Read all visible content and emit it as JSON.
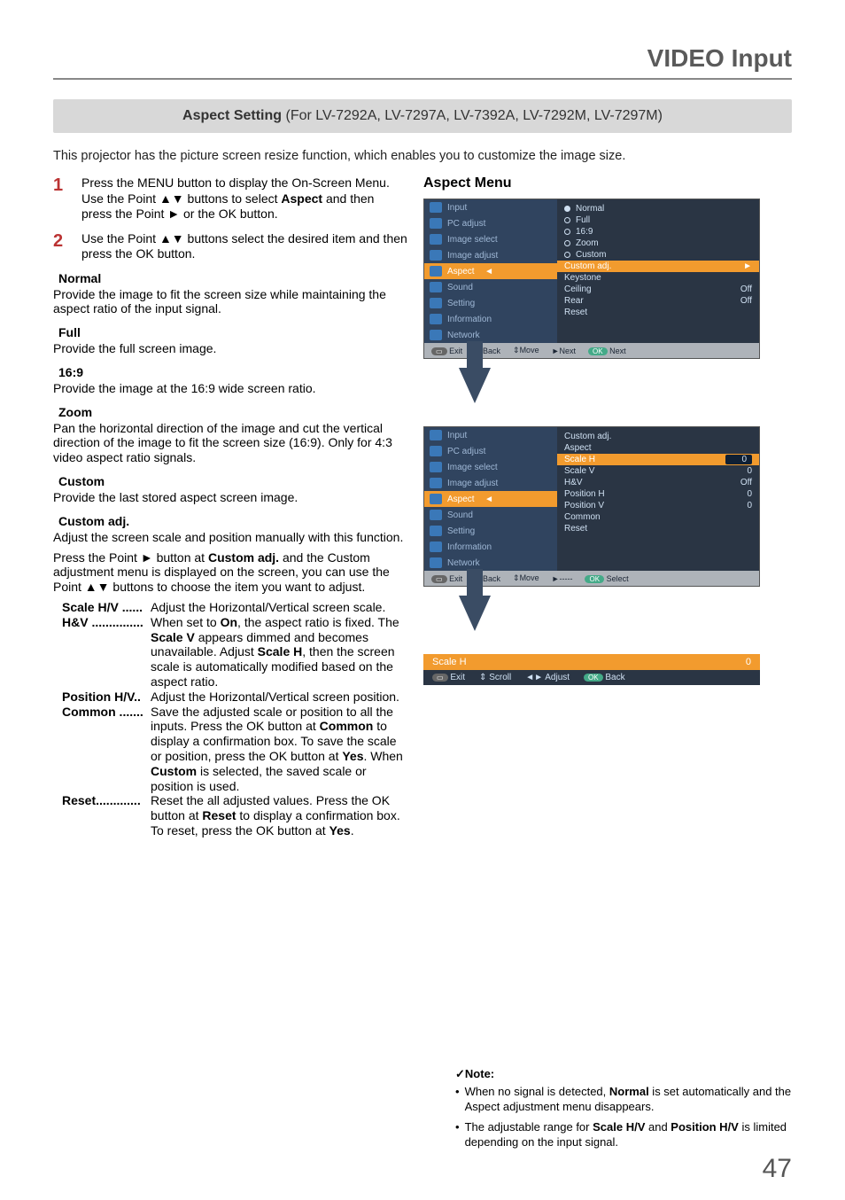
{
  "header": {
    "title": "VIDEO Input"
  },
  "section": {
    "title_bold": "Aspect Setting",
    "title_rest": "(For LV-7292A, LV-7297A, LV-7392A, LV-7292M, LV-7297M)"
  },
  "intro": "This projector has the picture screen resize function, which enables you to customize the image size.",
  "steps": {
    "s1_num": "1",
    "s1_pre": "Press the MENU button to display the On-Screen Menu. Use the Point ▲▼ buttons to select ",
    "s1_bold": "Aspect",
    "s1_post": " and then press the Point ► or the OK button.",
    "s2_num": "2",
    "s2": "Use the Point ▲▼ buttons select the desired item and then press the OK button."
  },
  "items": {
    "normal_h": "Normal",
    "normal_p": "Provide the image to fit the screen size while maintaining the aspect ratio of the input signal.",
    "full_h": "Full",
    "full_p": "Provide the full screen image.",
    "r169_h": "16:9",
    "r169_p": "Provide the image at the 16:9 wide screen ratio.",
    "zoom_h": "Zoom",
    "zoom_p": "Pan the horizontal direction of the image and cut the vertical direction of the image to fit the screen size (16:9). Only for 4:3 video aspect ratio signals.",
    "custom_h": "Custom",
    "custom_p": "Provide the last stored aspect screen image.",
    "cadj_h": "Custom adj.",
    "cadj_p1": "Adjust the screen scale and position manually with this function.",
    "cadj_p2_a": "Press the Point ► button at ",
    "cadj_p2_b": "Custom adj.",
    "cadj_p2_c": " and the Custom adjustment menu is displayed on the screen, you can use the Point ▲▼ buttons to choose the item you want to adjust.",
    "def_scale_l": "Scale H/V",
    "def_scale_v": "Adjust the Horizontal/Vertical screen scale.",
    "def_hv_l": "H&V",
    "def_hv_v_a": "When set to ",
    "def_hv_v_b": "On",
    "def_hv_v_c": ", the aspect ratio is fixed. The ",
    "def_hv_v_d": "Scale V",
    "def_hv_v_e": " appears dimmed and becomes unavailable. Adjust ",
    "def_hv_v_f": "Scale H",
    "def_hv_v_g": ", then the screen scale is automatically modified based on the aspect ratio.",
    "def_pos_l": "Position H/V",
    "def_pos_v": "Adjust the Horizontal/Vertical screen position.",
    "def_com_l": "Common",
    "def_com_v_a": "Save the adjusted scale or position to all the inputs. Press the OK button at ",
    "def_com_v_b": "Common",
    "def_com_v_c": " to display a confirmation box. To save the scale or position, press the OK button at ",
    "def_com_v_d": "Yes",
    "def_com_v_e": ". When ",
    "def_com_v_f": "Custom",
    "def_com_v_g": " is selected, the saved scale or position is used.",
    "def_reset_l": "Reset",
    "def_reset_v_a": "Reset the all adjusted values. Press the OK button at ",
    "def_reset_v_b": "Reset",
    "def_reset_v_c": " to display a confirmation box. To reset, press the OK button at ",
    "def_reset_v_d": "Yes",
    "def_reset_v_e": "."
  },
  "aspect_menu_h": "Aspect Menu",
  "osd_menu": {
    "items": [
      "Input",
      "PC adjust",
      "Image select",
      "Image adjust",
      "Aspect",
      "Sound",
      "Setting",
      "Information",
      "Network"
    ]
  },
  "osd1_opts": {
    "normal": "Normal",
    "full": "Full",
    "r169": "16:9",
    "zoom": "Zoom",
    "custom": "Custom",
    "cadj": "Custom adj.",
    "keystone": "Keystone",
    "ceiling": "Ceiling",
    "rear": "Rear",
    "reset": "Reset",
    "off": "Off"
  },
  "osd2": {
    "title": "Custom adj.",
    "sub": "Aspect",
    "rows": {
      "sh": "Scale H",
      "sv": "Scale V",
      "hv": "H&V",
      "ph": "Position H",
      "pv": "Position V",
      "common": "Common",
      "reset": "Reset"
    },
    "vals": {
      "sh": "0",
      "sv": "0",
      "hv": "Off",
      "ph": "0",
      "pv": "0"
    }
  },
  "footer": {
    "exit": "Exit",
    "back": "◄Back",
    "move": "Move",
    "next": "►Next",
    "oknext": "Next",
    "select": "Select",
    "scroll": "Scroll",
    "adjust": "Adjust",
    "okback": "Back",
    "dash": "►-----",
    "movearrows": "⇕"
  },
  "slider": {
    "label": "Scale H",
    "value": "0"
  },
  "note": {
    "h": "Note:",
    "n1_a": "When no signal is detected, ",
    "n1_b": "Normal",
    "n1_c": " is set automatically and the Aspect adjustment menu disappears.",
    "n2_a": "The adjustable range for ",
    "n2_b": "Scale H/V",
    "n2_c": " and ",
    "n2_d": "Position H/V",
    "n2_e": " is limited depending on the input signal."
  },
  "page": "47"
}
